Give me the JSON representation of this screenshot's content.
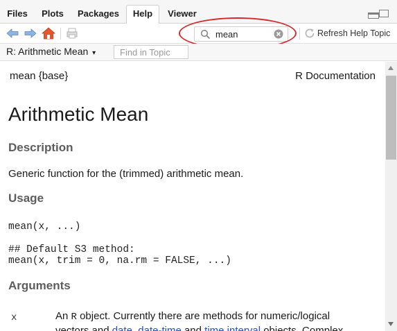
{
  "tabs": [
    {
      "label": "Files"
    },
    {
      "label": "Plots"
    },
    {
      "label": "Packages"
    },
    {
      "label": "Help",
      "active": true
    },
    {
      "label": "Viewer"
    }
  ],
  "toolbar": {
    "back_icon": "arrow-left-icon",
    "forward_icon": "arrow-right-icon",
    "home_icon": "home-icon",
    "print_icon": "print-icon",
    "search_value": "mean",
    "search_icon": "search-icon",
    "clear_icon": "clear-icon",
    "refresh_icon": "refresh-icon",
    "refresh_label": "Refresh Help Topic",
    "annotation_color": "#d42a2a"
  },
  "topic_bar": {
    "topic_label": "R: Arithmetic Mean",
    "find_placeholder": "Find in Topic"
  },
  "doc": {
    "header_left": "mean {base}",
    "header_right": "R Documentation",
    "title": "Arithmetic Mean",
    "description_heading": "Description",
    "description_text": "Generic function for the (trimmed) arithmetic mean.",
    "usage_heading": "Usage",
    "usage_line1": "mean(x, ...)",
    "usage_line2": "## Default S3 method:",
    "usage_line3": "mean(x, trim = 0, na.rm = FALSE, ...)",
    "arguments_heading": "Arguments",
    "arg_name": "x",
    "arg_text_1": "An ",
    "arg_code": "R",
    "arg_text_2": " object. Currently there are methods for numeric/logical",
    "arg_text_3": "vectors and ",
    "arg_link_1": "date",
    "arg_sep_1": ", ",
    "arg_link_2": "date-time",
    "arg_sep_2": " and ",
    "arg_link_3": "time interval",
    "arg_text_4": " objects. Complex"
  },
  "colors": {
    "link": "#1d4ed8",
    "heading": "#5d5d5d",
    "tab_bar_bg": "#f6f6f6"
  }
}
